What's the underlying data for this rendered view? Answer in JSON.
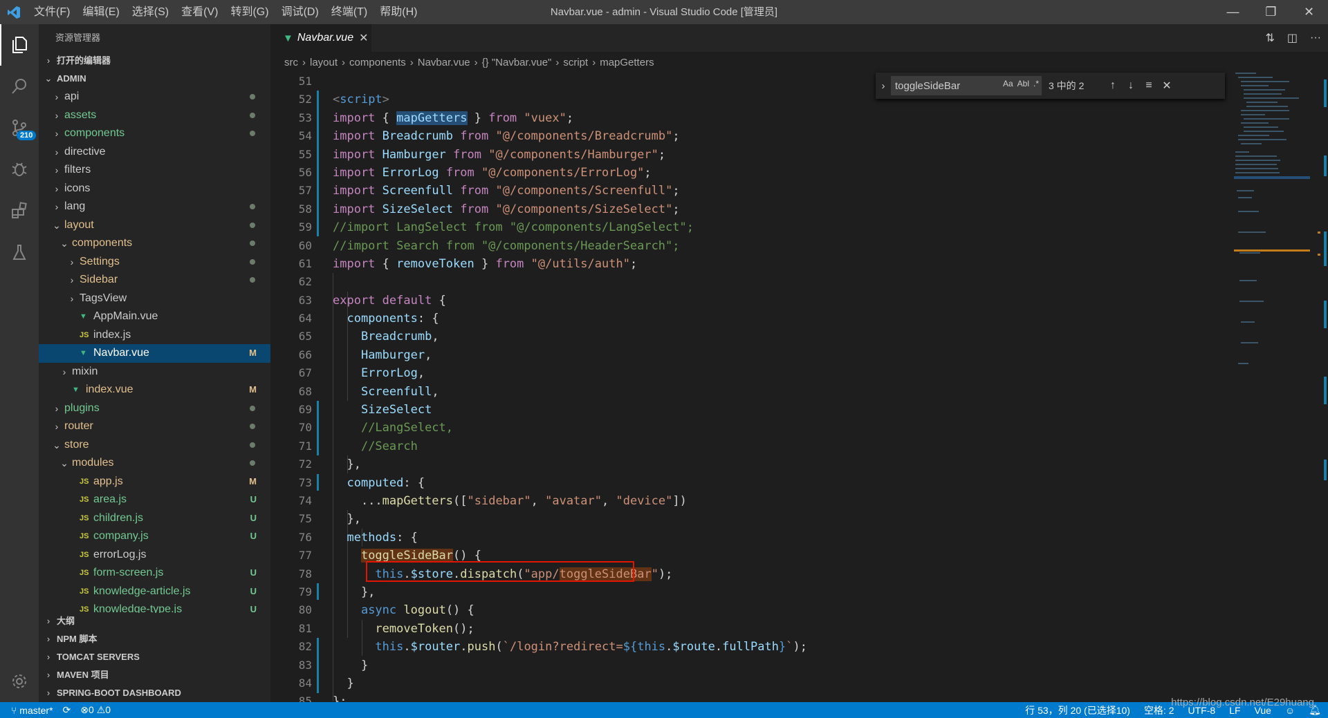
{
  "titlebar": {
    "menu": [
      "文件(F)",
      "编辑(E)",
      "选择(S)",
      "查看(V)",
      "转到(G)",
      "调试(D)",
      "终端(T)",
      "帮助(H)"
    ],
    "title": "Navbar.vue - admin - Visual Studio Code [管理员]"
  },
  "activity": {
    "scm_badge": "210"
  },
  "sidebar": {
    "header": "资源管理器",
    "open_editors": "打开的编辑器",
    "root": "ADMIN",
    "tree": [
      {
        "label": "api",
        "chev": "›",
        "indent": 1,
        "icon": "",
        "color": "white",
        "dec": "",
        "dot": true
      },
      {
        "label": "assets",
        "chev": "›",
        "indent": 1,
        "icon": "",
        "color": "green",
        "dec": "",
        "dot": true
      },
      {
        "label": "components",
        "chev": "›",
        "indent": 1,
        "icon": "",
        "color": "green",
        "dec": "",
        "dot": true
      },
      {
        "label": "directive",
        "chev": "›",
        "indent": 1,
        "icon": "",
        "color": "white",
        "dec": "",
        "dot": false
      },
      {
        "label": "filters",
        "chev": "›",
        "indent": 1,
        "icon": "",
        "color": "white",
        "dec": "",
        "dot": false
      },
      {
        "label": "icons",
        "chev": "›",
        "indent": 1,
        "icon": "",
        "color": "white",
        "dec": "",
        "dot": false
      },
      {
        "label": "lang",
        "chev": "›",
        "indent": 1,
        "icon": "",
        "color": "white",
        "dec": "",
        "dot": true
      },
      {
        "label": "layout",
        "chev": "⌄",
        "indent": 1,
        "icon": "",
        "color": "yellow",
        "dec": "",
        "dot": true
      },
      {
        "label": "components",
        "chev": "⌄",
        "indent": 2,
        "icon": "",
        "color": "yellow",
        "dec": "",
        "dot": true
      },
      {
        "label": "Settings",
        "chev": "›",
        "indent": 3,
        "icon": "",
        "color": "yellow",
        "dec": "",
        "dot": true
      },
      {
        "label": "Sidebar",
        "chev": "›",
        "indent": 3,
        "icon": "",
        "color": "yellow",
        "dec": "",
        "dot": true
      },
      {
        "label": "TagsView",
        "chev": "›",
        "indent": 3,
        "icon": "",
        "color": "white",
        "dec": "",
        "dot": false
      },
      {
        "label": "AppMain.vue",
        "chev": "",
        "indent": 3,
        "icon": "vue",
        "color": "white",
        "dec": "",
        "dot": false
      },
      {
        "label": "index.js",
        "chev": "",
        "indent": 3,
        "icon": "js",
        "color": "white",
        "dec": "",
        "dot": false
      },
      {
        "label": "Navbar.vue",
        "chev": "",
        "indent": 3,
        "icon": "vue",
        "color": "yellow",
        "dec": "M",
        "dot": false,
        "selected": true
      },
      {
        "label": "mixin",
        "chev": "›",
        "indent": 2,
        "icon": "",
        "color": "white",
        "dec": "",
        "dot": false
      },
      {
        "label": "index.vue",
        "chev": "",
        "indent": 2,
        "icon": "vue",
        "color": "yellow",
        "dec": "M",
        "dot": false
      },
      {
        "label": "plugins",
        "chev": "›",
        "indent": 1,
        "icon": "",
        "color": "green",
        "dec": "",
        "dot": true
      },
      {
        "label": "router",
        "chev": "›",
        "indent": 1,
        "icon": "",
        "color": "yellow",
        "dec": "",
        "dot": true
      },
      {
        "label": "store",
        "chev": "⌄",
        "indent": 1,
        "icon": "",
        "color": "yellow",
        "dec": "",
        "dot": true
      },
      {
        "label": "modules",
        "chev": "⌄",
        "indent": 2,
        "icon": "",
        "color": "yellow",
        "dec": "",
        "dot": true
      },
      {
        "label": "app.js",
        "chev": "",
        "indent": 3,
        "icon": "js",
        "color": "yellow",
        "dec": "M",
        "dot": false
      },
      {
        "label": "area.js",
        "chev": "",
        "indent": 3,
        "icon": "js",
        "color": "green",
        "dec": "U",
        "dot": false
      },
      {
        "label": "children.js",
        "chev": "",
        "indent": 3,
        "icon": "js",
        "color": "green",
        "dec": "U",
        "dot": false
      },
      {
        "label": "company.js",
        "chev": "",
        "indent": 3,
        "icon": "js",
        "color": "green",
        "dec": "U",
        "dot": false
      },
      {
        "label": "errorLog.js",
        "chev": "",
        "indent": 3,
        "icon": "js",
        "color": "white",
        "dec": "",
        "dot": false
      },
      {
        "label": "form-screen.js",
        "chev": "",
        "indent": 3,
        "icon": "js",
        "color": "green",
        "dec": "U",
        "dot": false
      },
      {
        "label": "knowledge-article.js",
        "chev": "",
        "indent": 3,
        "icon": "js",
        "color": "green",
        "dec": "U",
        "dot": false
      },
      {
        "label": "knowledge-type.js",
        "chev": "",
        "indent": 3,
        "icon": "js",
        "color": "green",
        "dec": "U",
        "dot": false
      }
    ],
    "bottom_sections": [
      "大纲",
      "NPM 脚本",
      "TOMCAT SERVERS",
      "MAVEN 项目",
      "SPRING-BOOT DASHBOARD"
    ]
  },
  "tab": {
    "label": "Navbar.vue"
  },
  "breadcrumbs": [
    "src",
    "layout",
    "components",
    "Navbar.vue",
    "{} \"Navbar.vue\"",
    "script",
    "mapGetters"
  ],
  "find": {
    "query": "toggleSideBar",
    "count": "3 中的 2",
    "opt_case": "Aa",
    "opt_word": "Abl",
    "opt_regex": ".*"
  },
  "editor": {
    "line_numbers": [
      "51",
      "52",
      "53",
      "54",
      "55",
      "56",
      "57",
      "58",
      "59",
      "60",
      "61",
      "62",
      "63",
      "64",
      "65",
      "66",
      "67",
      "68",
      "69",
      "70",
      "71",
      "72",
      "73",
      "74",
      "75",
      "76",
      "77",
      "78",
      "79",
      "80",
      "81",
      "82",
      "83",
      "84",
      "85"
    ]
  },
  "statusbar": {
    "branch": "master*",
    "problems": "0",
    "warnings": "0",
    "position": "行 53，列 20 (已选择10)",
    "spaces": "空格: 2",
    "encoding": "UTF-8",
    "eol": "LF",
    "language": "Vue",
    "watermark": "https://blog.csdn.net/E29huang"
  },
  "colors": {
    "accent": "#007acc",
    "selection": "#094771",
    "find_highlight": "#613214",
    "redbox": "#e51400"
  }
}
